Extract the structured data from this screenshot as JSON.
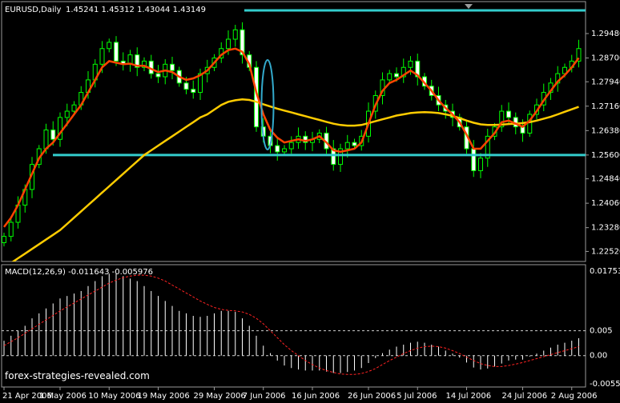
{
  "chart_data": {
    "type": "candlestick",
    "symbol_label": "EURUSD,Daily",
    "ohlc_label": "1.45241 1.45312 1.43044 1.43149",
    "price_axis": {
      "ylim": [
        1.2225,
        1.3045
      ],
      "ticks": [
        "1.29480",
        "1.28700",
        "1.27940",
        "1.27160",
        "1.26380",
        "1.25600",
        "1.24840",
        "1.24060",
        "1.23280",
        "1.22520"
      ]
    },
    "x_axis": {
      "ticks": [
        {
          "label": "21 Apr 2006",
          "index": 0
        },
        {
          "label": "1 May 2006",
          "index": 8
        },
        {
          "label": "10 May 2006",
          "index": 15
        },
        {
          "label": "19 May 2006",
          "index": 22
        },
        {
          "label": "29 May 2006",
          "index": 30
        },
        {
          "label": "7 Jun 2006",
          "index": 37
        },
        {
          "label": "16 Jun 2006",
          "index": 44
        },
        {
          "label": "26 Jun 2006",
          "index": 52
        },
        {
          "label": "5 Jul 2006",
          "index": 59
        },
        {
          "label": "14 Jul 2006",
          "index": 66
        },
        {
          "label": "24 Jul 2006",
          "index": 74
        },
        {
          "label": "2 Aug 2006",
          "index": 81
        }
      ]
    },
    "close": [
      1.23,
      1.2345,
      1.24,
      1.245,
      1.253,
      1.258,
      1.264,
      1.261,
      1.268,
      1.27,
      1.272,
      1.276,
      1.28,
      1.285,
      1.29,
      1.292,
      1.286,
      1.285,
      1.288,
      1.284,
      1.286,
      1.282,
      1.281,
      1.285,
      1.283,
      1.279,
      1.277,
      1.276,
      1.282,
      1.284,
      1.287,
      1.29,
      1.293,
      1.296,
      1.288,
      1.284,
      1.265,
      1.262,
      1.259,
      1.257,
      1.258,
      1.26,
      1.262,
      1.26,
      1.261,
      1.263,
      1.258,
      1.253,
      1.258,
      1.26,
      1.259,
      1.262,
      1.27,
      1.275,
      1.28,
      1.282,
      1.281,
      1.284,
      1.286,
      1.281,
      1.278,
      1.275,
      1.272,
      1.27,
      1.268,
      1.265,
      1.258,
      1.251,
      1.255,
      1.262,
      1.265,
      1.27,
      1.268,
      1.265,
      1.263,
      1.269,
      1.272,
      1.276,
      1.279,
      1.282,
      1.284,
      1.286,
      1.29
    ],
    "fast_ma": [
      1.233,
      1.236,
      1.24,
      1.245,
      1.25,
      1.255,
      1.258,
      1.26,
      1.263,
      1.266,
      1.269,
      1.272,
      1.276,
      1.28,
      1.284,
      1.286,
      1.2855,
      1.285,
      1.2852,
      1.2845,
      1.2845,
      1.2835,
      1.2825,
      1.283,
      1.2825,
      1.281,
      1.28,
      1.2805,
      1.2815,
      1.283,
      1.2855,
      1.288,
      1.2895,
      1.29,
      1.289,
      1.285,
      1.276,
      1.269,
      1.264,
      1.2615,
      1.26,
      1.2605,
      1.261,
      1.2605,
      1.261,
      1.262,
      1.26,
      1.2575,
      1.257,
      1.2575,
      1.258,
      1.26,
      1.266,
      1.272,
      1.2765,
      1.279,
      1.28,
      1.2815,
      1.283,
      1.2815,
      1.279,
      1.2765,
      1.2735,
      1.271,
      1.269,
      1.2665,
      1.2625,
      1.258,
      1.258,
      1.2605,
      1.263,
      1.2665,
      1.267,
      1.266,
      1.265,
      1.267,
      1.27,
      1.2735,
      1.2765,
      1.2795,
      1.2815,
      1.284,
      1.287
    ],
    "slow_ma": [
      1.22,
      1.2215,
      1.223,
      1.2245,
      1.226,
      1.2275,
      1.229,
      1.2305,
      1.232,
      1.234,
      1.236,
      1.238,
      1.24,
      1.242,
      1.244,
      1.246,
      1.248,
      1.25,
      1.252,
      1.254,
      1.256,
      1.2575,
      1.259,
      1.2605,
      1.262,
      1.2635,
      1.265,
      1.2665,
      1.268,
      1.269,
      1.2705,
      1.272,
      1.273,
      1.2735,
      1.2738,
      1.2736,
      1.273,
      1.2722,
      1.2715,
      1.2708,
      1.2702,
      1.2696,
      1.269,
      1.2684,
      1.2678,
      1.2672,
      1.2666,
      1.266,
      1.2656,
      1.2654,
      1.2654,
      1.2656,
      1.2662,
      1.2668,
      1.2674,
      1.268,
      1.2686,
      1.269,
      1.2694,
      1.2696,
      1.2697,
      1.2696,
      1.2694,
      1.269,
      1.2685,
      1.2678,
      1.267,
      1.2663,
      1.2658,
      1.2656,
      1.2656,
      1.2657,
      1.2659,
      1.266,
      1.2662,
      1.2665,
      1.267,
      1.2676,
      1.2682,
      1.269,
      1.2698,
      1.2706,
      1.2714
    ],
    "horizontal_lines": [
      1.3022,
      1.256
    ],
    "macd": {
      "label": "MACD(12,26,9) -0.011643 -0.005976",
      "ylim": [
        -0.006,
        0.0175
      ],
      "ticks": [
        "0.017534",
        "0.005",
        "0.00",
        "-0.005589"
      ],
      "histogram": [
        0.003,
        0.004,
        0.005,
        0.006,
        0.0075,
        0.0085,
        0.0095,
        0.0105,
        0.0115,
        0.012,
        0.0125,
        0.013,
        0.014,
        0.015,
        0.016,
        0.0165,
        0.0165,
        0.016,
        0.0155,
        0.015,
        0.014,
        0.013,
        0.012,
        0.011,
        0.01,
        0.009,
        0.0085,
        0.008,
        0.0078,
        0.008,
        0.0085,
        0.009,
        0.009,
        0.0088,
        0.0075,
        0.006,
        0.004,
        0.002,
        0.0005,
        -0.001,
        -0.002,
        -0.0025,
        -0.0028,
        -0.003,
        -0.003,
        -0.003,
        -0.0032,
        -0.0035,
        -0.0035,
        -0.0033,
        -0.003,
        -0.0025,
        -0.0015,
        -0.0005,
        0.0005,
        0.0012,
        0.0018,
        0.0022,
        0.0026,
        0.0028,
        0.0026,
        0.0022,
        0.0018,
        0.001,
        0.0004,
        -0.0004,
        -0.0014,
        -0.0024,
        -0.0028,
        -0.0026,
        -0.0022,
        -0.0016,
        -0.001,
        -0.0008,
        -0.0008,
        -0.0002,
        0.0004,
        0.001,
        0.0016,
        0.0022,
        0.0026,
        0.003,
        0.0035
      ],
      "signal": [
        0.002,
        0.0028,
        0.0036,
        0.0045,
        0.0054,
        0.0063,
        0.0072,
        0.0081,
        0.009,
        0.0098,
        0.0106,
        0.0114,
        0.0122,
        0.013,
        0.0138,
        0.0146,
        0.0152,
        0.0157,
        0.016,
        0.0162,
        0.0162,
        0.016,
        0.0156,
        0.015,
        0.0142,
        0.0134,
        0.0126,
        0.0118,
        0.011,
        0.0103,
        0.0097,
        0.0093,
        0.0091,
        0.009,
        0.0088,
        0.0083,
        0.0075,
        0.0064,
        0.005,
        0.0036,
        0.0022,
        0.001,
        0.0,
        -0.001,
        -0.0018,
        -0.0025,
        -0.003,
        -0.0034,
        -0.0037,
        -0.0038,
        -0.0038,
        -0.0036,
        -0.0032,
        -0.0026,
        -0.0018,
        -0.001,
        -0.0003,
        0.0004,
        0.001,
        0.0015,
        0.0018,
        0.0019,
        0.0018,
        0.0015,
        0.001,
        0.0004,
        -0.0003,
        -0.001,
        -0.0016,
        -0.002,
        -0.0022,
        -0.0022,
        -0.002,
        -0.0017,
        -0.0014,
        -0.001,
        -0.0006,
        -0.0002,
        0.0002,
        0.0006,
        0.001,
        0.0014,
        0.0018
      ]
    },
    "colors": {
      "background": "#000000",
      "grid": "#ffffff",
      "candle_up": "#00ff00",
      "candle_body_up": "#ffffff",
      "candle_down": "#00ff00",
      "fast_ma": "#ff4400",
      "slow_ma": "#ffcc00",
      "hline": "#33cccc",
      "ellipse": "#33aacc",
      "macd_hist": "#ffffff",
      "macd_signal": "#ff2222",
      "text": "#ffffff"
    },
    "watermark": "forex-strategies-revealed.com"
  }
}
